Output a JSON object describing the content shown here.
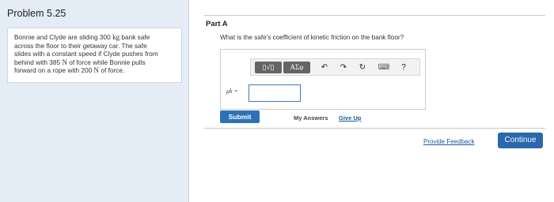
{
  "problem": {
    "title": "Problem 5.25",
    "text_lines": [
      {
        "pre": "Bonnie and Clyde are sliding 300 ",
        "sym": "kg",
        "post": " bank safe"
      },
      {
        "pre": "across the floor to their getaway car. The safe",
        "sym": "",
        "post": ""
      },
      {
        "pre": "slides with a constant speed if Clyde pushes from",
        "sym": "",
        "post": ""
      },
      {
        "pre": "behind with 385 ",
        "sym": "N",
        "post": " of force while Bonnie pulls"
      },
      {
        "pre": "forward on a rope with 200 ",
        "sym": "N",
        "post": " of force."
      }
    ]
  },
  "part": {
    "label": "Part A",
    "question": "What is the safe's coefficient of kinetic friction on the bank floor?",
    "variable_label": "μk =",
    "input_value": ""
  },
  "toolbar": {
    "template_label": "▯√▯",
    "symbols_label": "ΑΣφ",
    "undo_icon": "↶",
    "redo_icon": "↷",
    "reset_icon": "↻",
    "keyboard_icon": "⌨",
    "help_label": "?"
  },
  "actions": {
    "submit_label": "Submit",
    "my_answers_label": "My Answers",
    "give_up_label": "Give Up",
    "feedback_label": "Provide Feedback",
    "continue_label": "Continue"
  }
}
